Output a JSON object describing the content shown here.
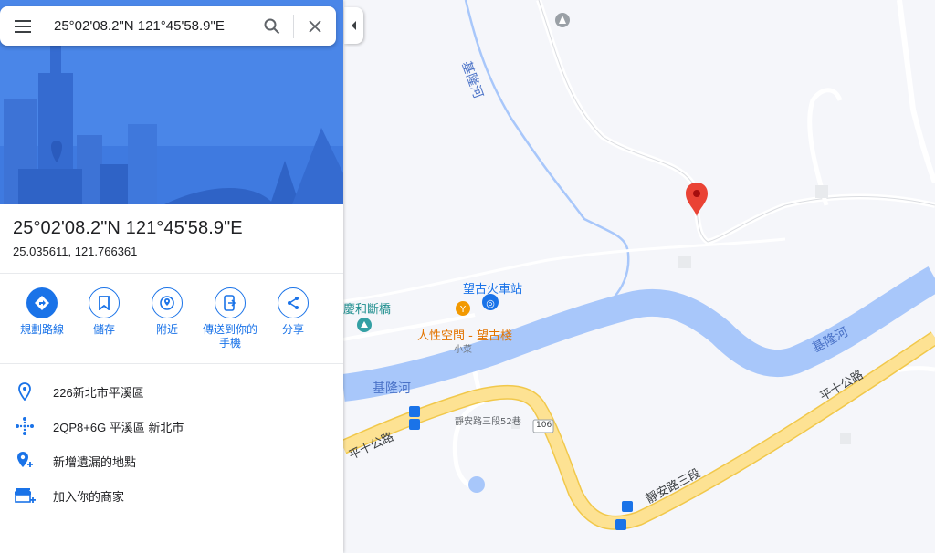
{
  "search": {
    "value": "25°02'08.2\"N 121°45'58.9\"E"
  },
  "place": {
    "title": "25°02'08.2\"N 121°45'58.9\"E",
    "coords": "25.035611, 121.766361"
  },
  "actions": [
    {
      "label": "規劃路線",
      "icon": "directions-icon"
    },
    {
      "label": "儲存",
      "icon": "bookmark-icon"
    },
    {
      "label": "附近",
      "icon": "nearby-icon"
    },
    {
      "label": "傳送到你的手機",
      "icon": "send-to-phone-icon"
    },
    {
      "label": "分享",
      "icon": "share-icon"
    }
  ],
  "info": [
    {
      "text": "226新北市平溪區",
      "icon": "location-pin-icon"
    },
    {
      "text": "2QP8+6G 平溪區 新北市",
      "icon": "plus-code-icon"
    },
    {
      "text": "新增遺漏的地點",
      "icon": "add-place-icon"
    },
    {
      "text": "加入你的商家",
      "icon": "add-business-icon"
    }
  ],
  "map": {
    "labels": {
      "river_top": "基隆河",
      "river_right": "基隆河",
      "river_left": "基隆河",
      "station": "望古火車站",
      "bridge": "慶和斷橋",
      "restaurant": "人性空間 - 望古棧",
      "restaurant_sub": "小菜",
      "road_left": "平十公路",
      "road_right": "平十公路",
      "road_lane": "靜安路三段52巷",
      "road_section": "靜安路三段",
      "route_number": "106"
    },
    "colors": {
      "river": "#a8c7fa",
      "road": "#fde293",
      "pin": "#ea4335",
      "accent": "#1a73e8"
    }
  }
}
